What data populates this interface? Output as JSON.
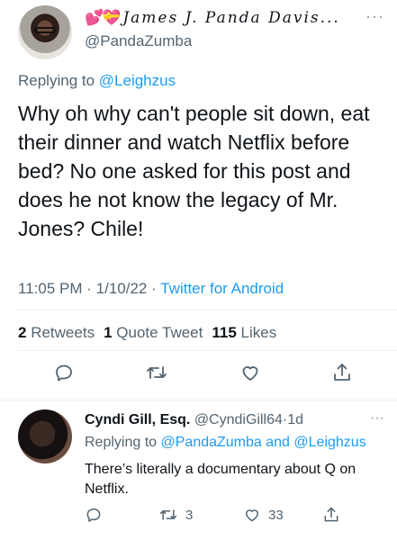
{
  "tweet": {
    "display_name": "James J. Panda Davis...",
    "name_emoji": "💕💝",
    "handle": "@PandaZumba",
    "more_label": "···",
    "replying_prefix": "Replying to ",
    "replying_to": "@Leighzus",
    "text": "Why oh why can't people sit down, eat their dinner and watch Netflix before bed? No one asked for this post and does he not know the legacy of Mr. Jones? Chile!",
    "time": "11:05 PM",
    "date": "1/10/22",
    "separator": "·",
    "source": "Twitter for Android",
    "stats": {
      "retweets_count": "2",
      "retweets_label": "Retweets",
      "quotes_count": "1",
      "quotes_label": "Quote Tweet",
      "likes_count": "115",
      "likes_label": "Likes"
    },
    "actions": [
      "reply-icon",
      "retweet-icon",
      "like-icon",
      "share-icon"
    ]
  },
  "reply": {
    "name": "Cyndi Gill, Esq.",
    "handle": "@CyndiGill64",
    "separator": "·",
    "age": "1d",
    "more_label": "···",
    "replying_prefix": "Replying to ",
    "replying_to_1": "@PandaZumba",
    "replying_and": " and ",
    "replying_to_2": "@Leighzus",
    "text": "There’s literally a documentary about Q on Netflix.",
    "retweet_count": "3",
    "like_count": "33"
  },
  "colors": {
    "accent": "#1d9bf0",
    "text": "#0f1419",
    "secondary": "#536471",
    "divider": "#eff3f4"
  }
}
